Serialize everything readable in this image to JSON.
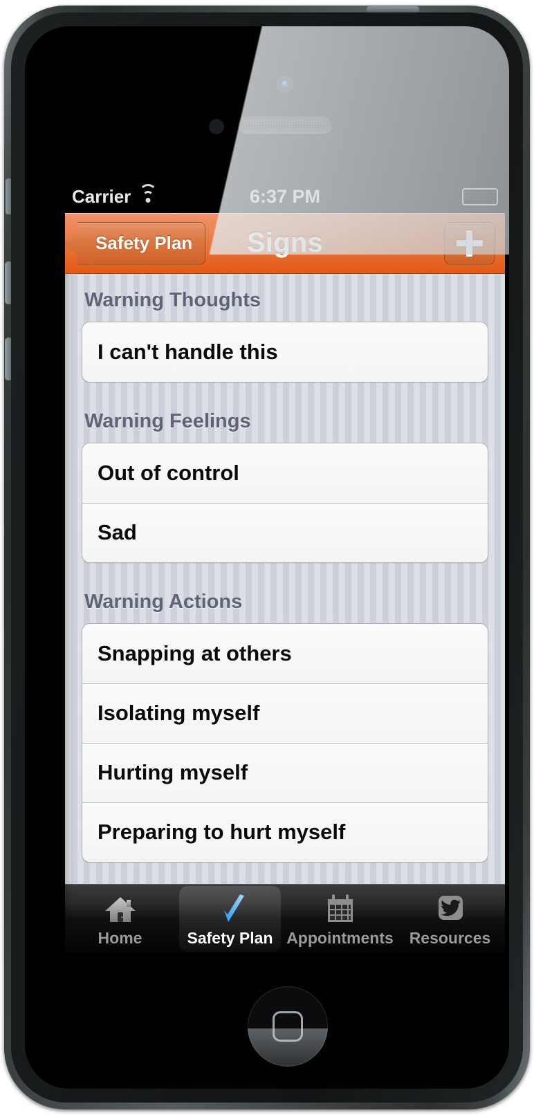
{
  "device": {
    "model_style": "iphone-black",
    "camera": "front-camera",
    "speaker": "earpiece-speaker",
    "home_button": "home-button"
  },
  "status_bar": {
    "carrier": "Carrier",
    "wifi_icon": "wifi-icon",
    "time": "6:37 PM",
    "battery_icon": "battery-full-icon"
  },
  "nav_bar": {
    "back_label": "Safety Plan",
    "title": "Signs",
    "add_label": "+",
    "accent_top": "#f0936a",
    "accent_bottom": "#e35a15"
  },
  "sections": [
    {
      "header": "Warning Thoughts",
      "rows": [
        {
          "label": "I can't handle this"
        }
      ]
    },
    {
      "header": "Warning Feelings",
      "rows": [
        {
          "label": "Out of control"
        },
        {
          "label": "Sad"
        }
      ]
    },
    {
      "header": "Warning Actions",
      "rows": [
        {
          "label": "Snapping at others"
        },
        {
          "label": "Isolating myself"
        },
        {
          "label": "Hurting myself"
        },
        {
          "label": "Preparing to hurt myself"
        }
      ]
    }
  ],
  "tab_bar": {
    "items": [
      {
        "label": "Home",
        "icon": "home-icon",
        "selected": false
      },
      {
        "label": "Safety Plan",
        "icon": "checkmark-icon",
        "selected": true
      },
      {
        "label": "Appointments",
        "icon": "calendar-icon",
        "selected": false
      },
      {
        "label": "Resources",
        "icon": "twitter-bird-icon",
        "selected": false
      }
    ],
    "selected_color": "#ffffff",
    "unselected_color": "#9a9a9a"
  }
}
